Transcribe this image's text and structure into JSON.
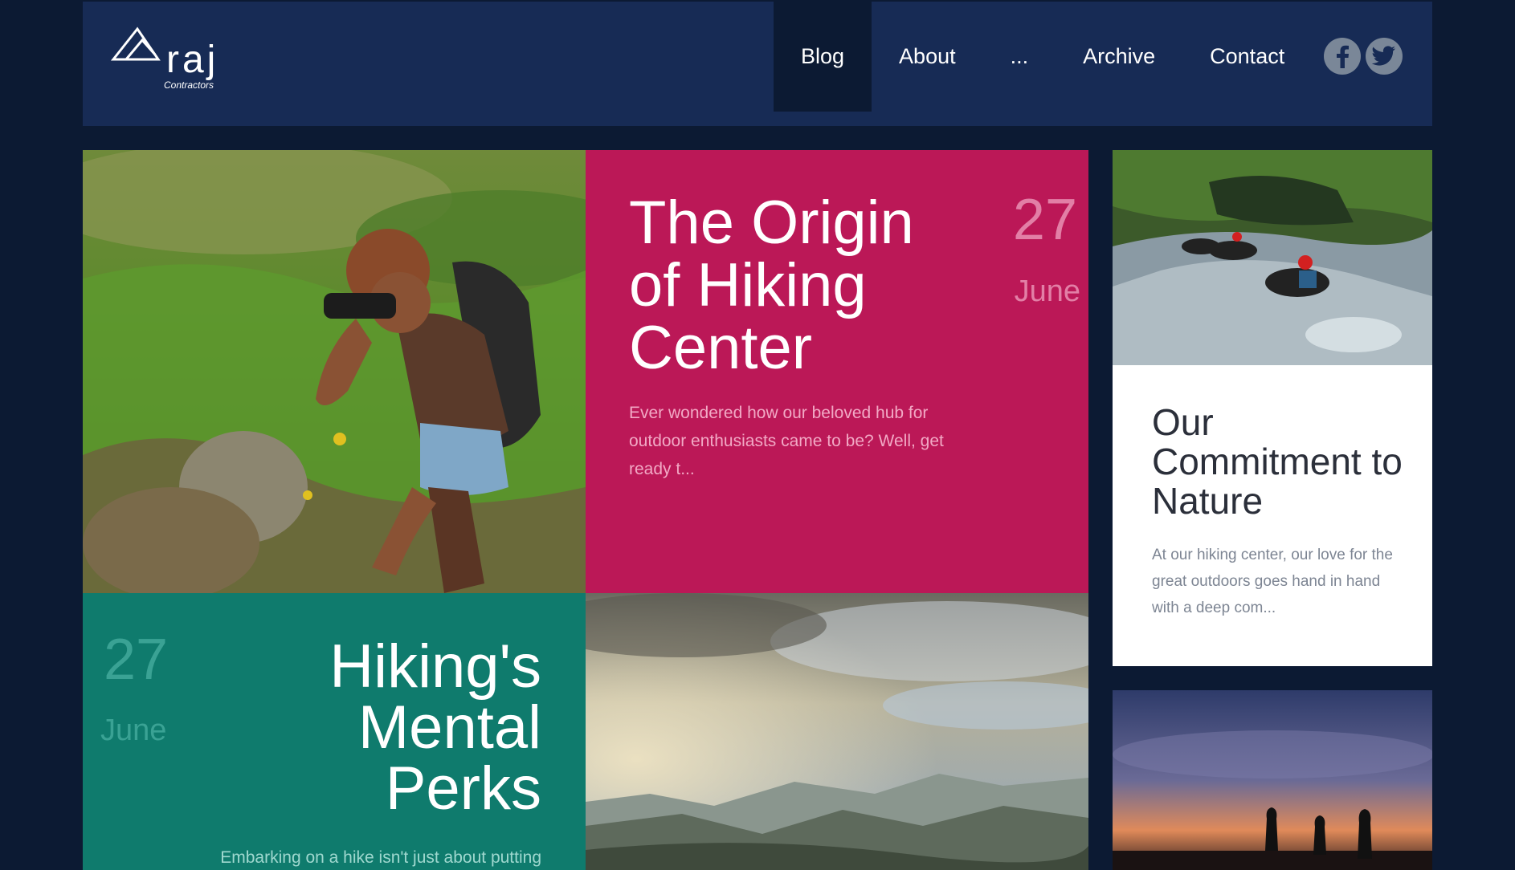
{
  "brand": {
    "name": "raj",
    "tagline": "Contractors"
  },
  "nav": {
    "items": [
      {
        "label": "Blog",
        "active": true
      },
      {
        "label": "About"
      },
      {
        "label": "..."
      },
      {
        "label": "Archive"
      },
      {
        "label": "Contact"
      }
    ]
  },
  "social": {
    "facebook_icon": "facebook-icon",
    "twitter_icon": "twitter-icon"
  },
  "posts": {
    "origin": {
      "title": "The Origin of Hiking Center",
      "day": "27",
      "month": "June",
      "excerpt": "Ever wondered how our beloved hub for outdoor enthusiasts came to be? Well, get ready t..."
    },
    "commitment": {
      "title": "Our Commitment to Nature",
      "excerpt": "At our hiking center, our love for the great outdoors goes hand in hand with a deep com..."
    },
    "mental": {
      "title": "Hiking's Mental Perks",
      "day": "27",
      "month": "June",
      "excerpt": "Embarking on a hike isn't just about putting"
    }
  },
  "colors": {
    "background": "#0c1a33",
    "header": "#172b55",
    "red_card": "#bb1857",
    "teal_card": "#0f7b6d",
    "white_card": "#ffffff"
  }
}
